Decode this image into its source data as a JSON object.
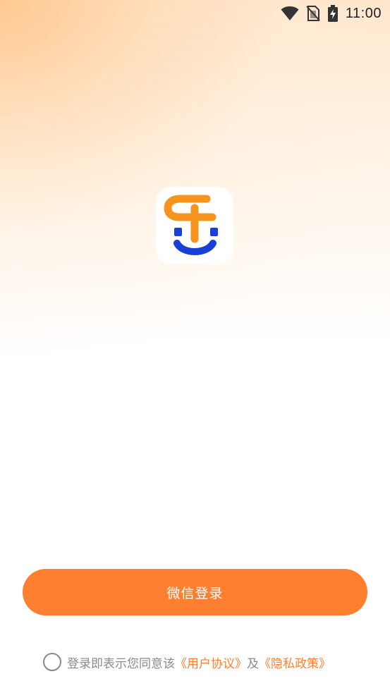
{
  "status_bar": {
    "time": "11:00",
    "icons": [
      "wifi-icon",
      "no-sim-icon",
      "battery-charging-icon"
    ]
  },
  "logo": {
    "name": "app-logo",
    "colors": {
      "orange": "#F7941D",
      "blue": "#1A3FD6"
    }
  },
  "login": {
    "button_label": "微信登录",
    "button_color": "#FF7F30"
  },
  "agreement": {
    "prefix": "登录即表示您同意该",
    "user_agreement": "《用户协议》",
    "conjunction": "及",
    "privacy_policy": "《隐私政策》",
    "link_color": "#FF7F30"
  }
}
